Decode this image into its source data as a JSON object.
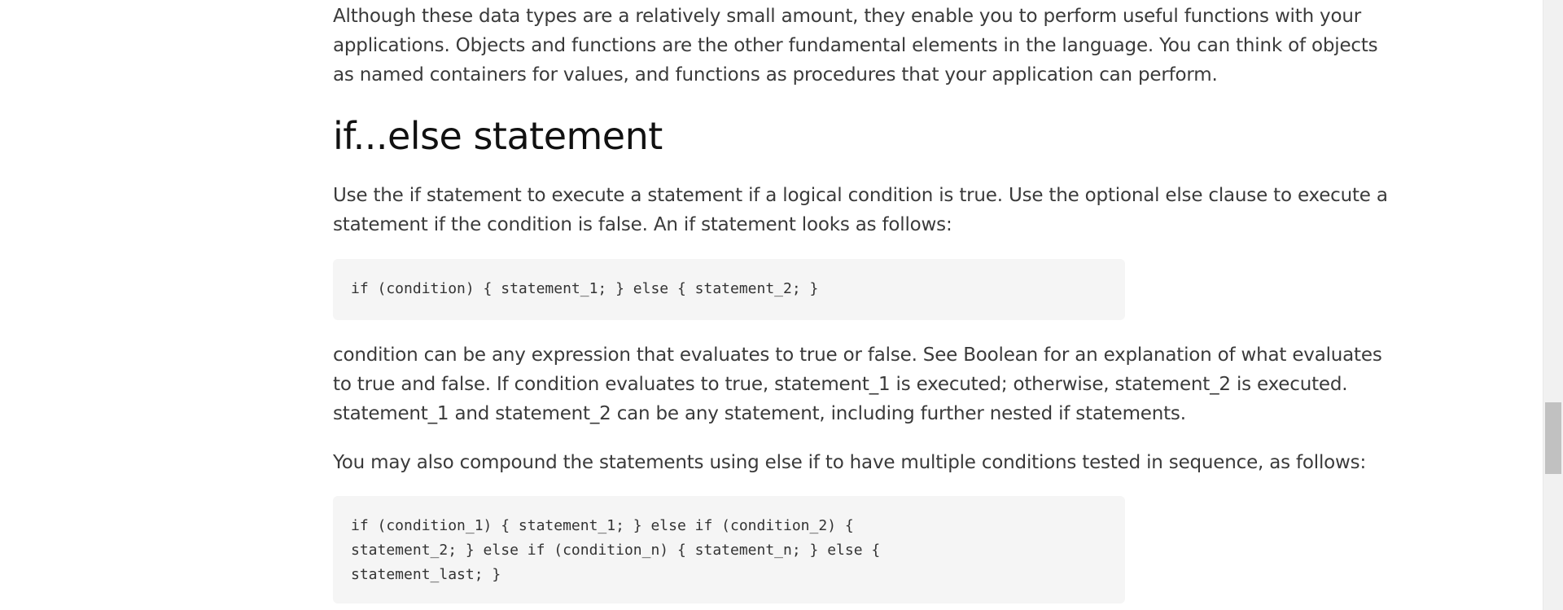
{
  "article": {
    "intro_paragraph": "Although these data types are a relatively small amount, they enable you to perform useful functions with your applications. Objects and functions are the other fundamental elements in the language. You can think of objects as named containers for values, and functions as procedures that your application can perform.",
    "section_heading": "if...else statement",
    "usage_paragraph": "Use the if statement to execute a statement if a logical condition is true. Use the optional else clause to execute a statement if the condition is false. An if statement looks as follows:",
    "code_example_1": "if (condition) { statement_1; } else { statement_2; }",
    "condition_paragraph": "condition can be any expression that evaluates to true or false. See Boolean for an explanation of what evaluates to true and false. If condition evaluates to true, statement_1 is executed; otherwise, statement_2 is executed. statement_1 and statement_2 can be any statement, including further nested if statements.",
    "compound_paragraph": "You may also compound the statements using else if to have multiple conditions tested in sequence, as follows:",
    "code_example_2": "if (condition_1) { statement_1; } else if (condition_2) {\nstatement_2; } else if (condition_n) { statement_n; } else {\nstatement_last; }"
  }
}
